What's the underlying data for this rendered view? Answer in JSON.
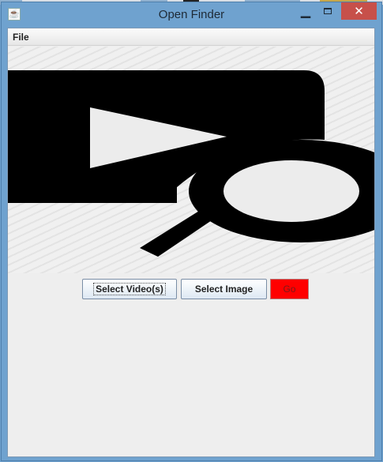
{
  "window": {
    "title": "Open Finder",
    "icon": "java-icon"
  },
  "menubar": {
    "items": [
      {
        "label": "File"
      }
    ]
  },
  "banner": {
    "icon": "video-search-icon"
  },
  "buttons": {
    "select_videos": "Select Video(s)",
    "select_image": "Select Image",
    "go": "Go"
  },
  "colors": {
    "go_button": "#ff0000",
    "close_button": "#c7504a",
    "window_frame": "#6fa2cf"
  }
}
